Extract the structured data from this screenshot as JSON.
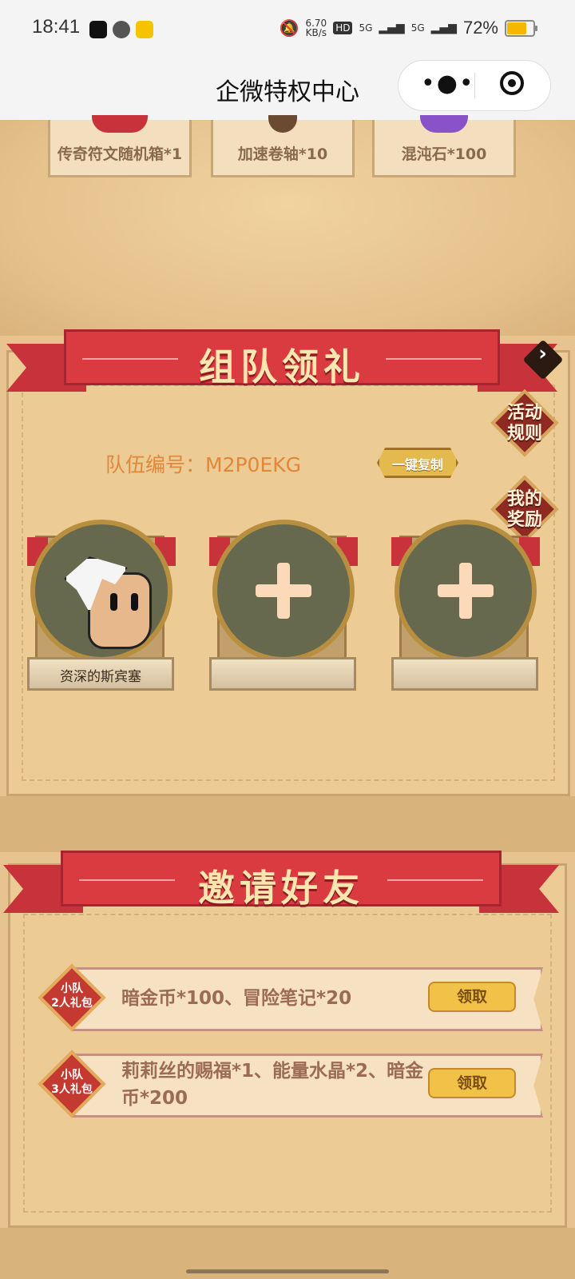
{
  "status_bar": {
    "time": "18:41",
    "network_speed": "6.70\nKB/s",
    "hd_label": "HD",
    "signal1": "5G",
    "signal2": "5G",
    "battery": "72%",
    "battery_level": 0.72,
    "icons": [
      "tiktok-icon",
      "wechat-icon",
      "app-icon",
      "mute-icon"
    ]
  },
  "nav": {
    "title": "企微特权中心",
    "more_icon": "more-dots-icon",
    "close_icon": "target-icon"
  },
  "top_rewards": [
    {
      "label": "传奇符文随机箱*1"
    },
    {
      "label": "加速卷轴*10"
    },
    {
      "label": "混沌石*100"
    }
  ],
  "team_section": {
    "banner_title": "组队领礼",
    "team_id_label": "队伍编号：M2P0EKG",
    "copy_button": "一键复制",
    "rules_button": "活动\n规则",
    "my_rewards_button": "我的\n奖励",
    "members": [
      {
        "name": "资深的斯宾塞",
        "filled": true
      },
      {
        "name": "",
        "filled": false
      },
      {
        "name": "",
        "filled": false
      }
    ]
  },
  "invite_section": {
    "banner_title": "邀请好友",
    "rows": [
      {
        "badge": "小队\n2人礼包",
        "rewards": "暗金币*100、冒险笔记*20",
        "button": "领取"
      },
      {
        "badge": "小队\n3人礼包",
        "rewards": "莉莉丝的赐福*1、能量水晶*2、暗金币*200",
        "button": "领取"
      }
    ]
  },
  "colors": {
    "banner_red": "#d93b40",
    "panel_bg": "#eccb95",
    "button_gold": "#f2c248",
    "team_text": "#e0873a"
  }
}
